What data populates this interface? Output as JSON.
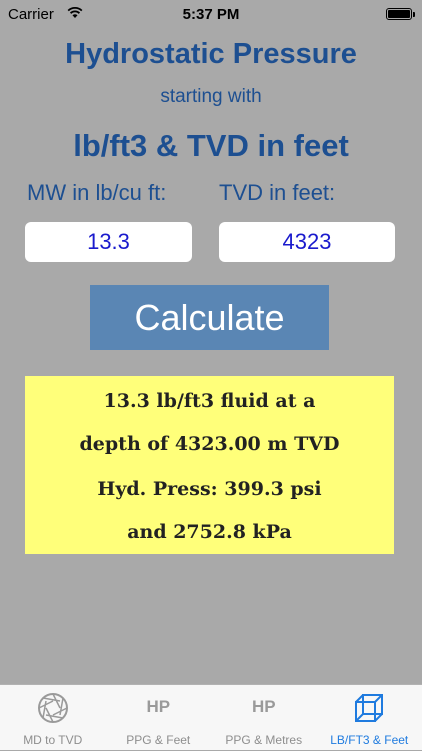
{
  "status": {
    "carrier": "Carrier",
    "time": "5:37 PM",
    "battery_level": 1.0
  },
  "header": {
    "title": "Hydrostatic Pressure",
    "subtitle": "starting with",
    "units": "lb/ft3 & TVD in feet"
  },
  "inputs": {
    "mw_label": "MW in lb/cu ft:",
    "mw_value": "13.3",
    "tvd_label": "TVD in feet:",
    "tvd_value": "4323"
  },
  "calculate_label": "Calculate",
  "result": {
    "line1": "13.3 lb/ft3 fluid at a",
    "line2": "depth of 4323.00 m TVD",
    "line3": "Hyd. Press: 399.3 psi",
    "line4": "and 2752.8 kPa"
  },
  "tabs": [
    {
      "label": "MD to TVD",
      "icon": "aperture-icon"
    },
    {
      "label": "PPG & Feet",
      "icon": "hp-icon",
      "icon_text": "HP"
    },
    {
      "label": "PPG & Metres",
      "icon": "hp-icon",
      "icon_text": "HP"
    },
    {
      "label": "LB/FT3 & Feet",
      "icon": "cube-icon",
      "active": true
    }
  ],
  "colors": {
    "background": "#a9a9a9",
    "heading": "#1d4f91",
    "button": "#5a86b4",
    "result_bg": "#ffff7a",
    "active_tab": "#1f7bdf"
  }
}
